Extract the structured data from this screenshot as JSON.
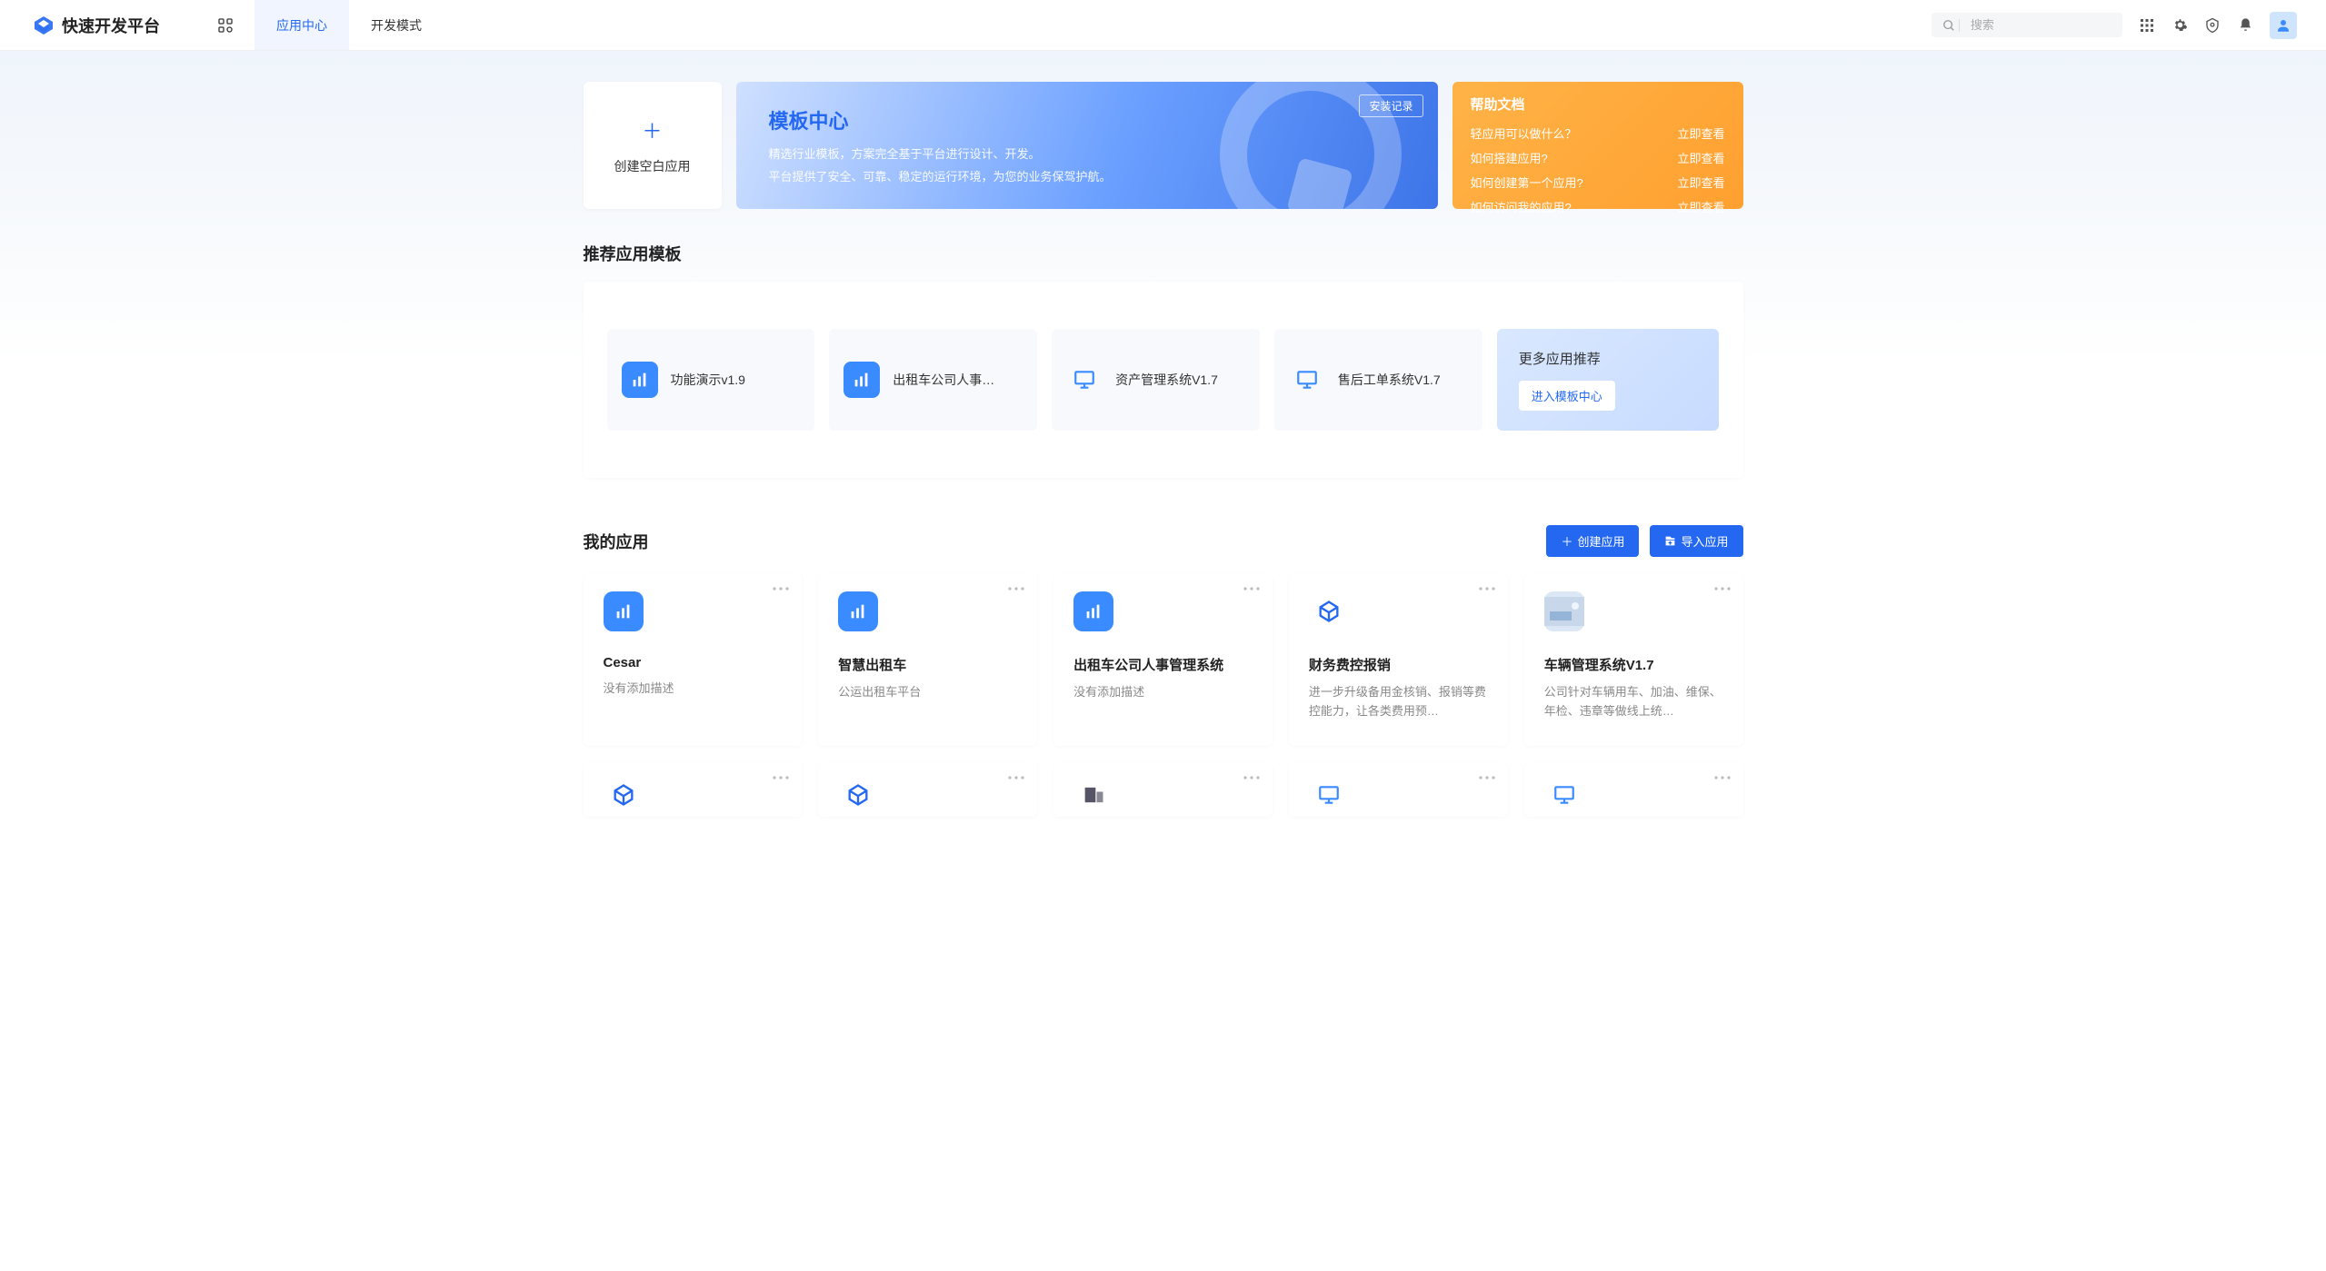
{
  "header": {
    "logo_text": "快速开发平台",
    "tabs": [
      {
        "id": "home",
        "label": ""
      },
      {
        "id": "appcenter",
        "label": "应用中心"
      },
      {
        "id": "devmode",
        "label": "开发模式"
      }
    ],
    "search_placeholder": "搜索"
  },
  "create": {
    "label": "创建空白应用"
  },
  "template_banner": {
    "title": "模板中心",
    "line1": "精选行业模板，方案完全基于平台进行设计、开发。",
    "line2": "平台提供了安全、可靠、稳定的运行环境，为您的业务保驾护航。",
    "badge": "安装记录"
  },
  "help": {
    "title": "帮助文档",
    "items": [
      {
        "q": "轻应用可以做什么？",
        "a": "立即查看"
      },
      {
        "q": "如何搭建应用?",
        "a": "立即查看"
      },
      {
        "q": "如何创建第一个应用?",
        "a": "立即查看"
      },
      {
        "q": "如何访问我的应用?",
        "a": "立即查看"
      }
    ]
  },
  "recommended": {
    "title": "推荐应用模板",
    "items": [
      {
        "name": "功能演示v1.9",
        "icon": "chart"
      },
      {
        "name": "出租车公司人事…",
        "icon": "chart"
      },
      {
        "name": "资产管理系统V1.7",
        "icon": "board"
      },
      {
        "name": "售后工单系统V1.7",
        "icon": "board"
      }
    ],
    "more_title": "更多应用推荐",
    "more_btn": "进入模板中心"
  },
  "my_apps": {
    "title": "我的应用",
    "create_btn": "创建应用",
    "import_btn": "导入应用",
    "items": [
      {
        "name": "Cesar",
        "desc": "没有添加描述",
        "icon": "chart-fill"
      },
      {
        "name": "智慧出租车",
        "desc": "公运出租车平台",
        "icon": "chart-fill"
      },
      {
        "name": "出租车公司人事管理系统",
        "desc": "没有添加描述",
        "icon": "chart-fill"
      },
      {
        "name": "财务费控报销",
        "desc": "进一步升级备用金核销、报销等费控能力，让各类费用预…",
        "icon": "logo-outline"
      },
      {
        "name": "车辆管理系统V1.7",
        "desc": "公司针对车辆用车、加油、维保、年检、违章等做线上统…",
        "icon": "image"
      }
    ],
    "partial": [
      {
        "icon": "logo-outline"
      },
      {
        "icon": "logo-outline"
      },
      {
        "icon": "server"
      },
      {
        "icon": "board-outline"
      },
      {
        "icon": "board-outline"
      }
    ]
  }
}
